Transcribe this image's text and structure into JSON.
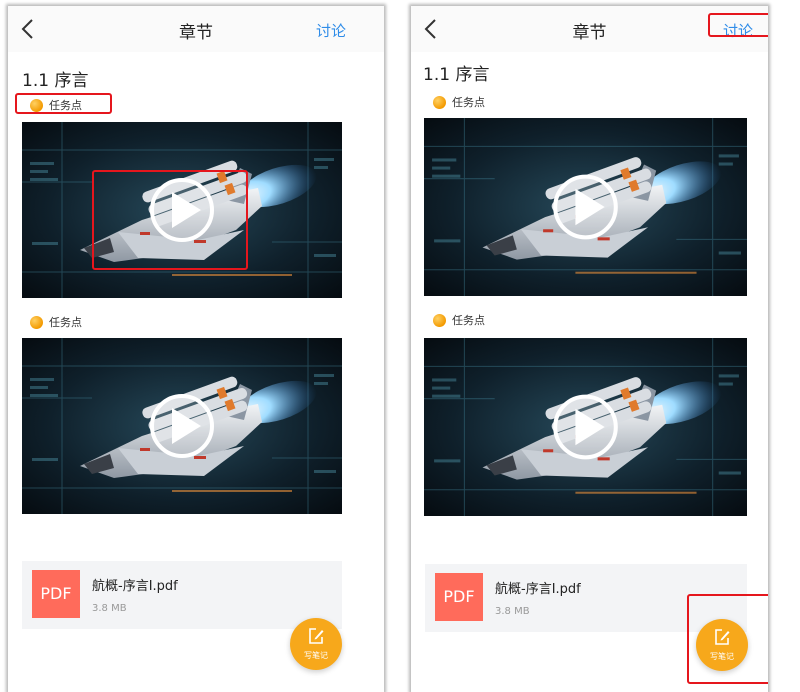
{
  "screens": [
    {
      "nav_title": "章节",
      "discuss_label": "讨论",
      "section_title": "1.1 序言",
      "task_points": [
        "任务点",
        "任务点"
      ],
      "file": {
        "type_label": "PDF",
        "name": "航概-序言I.pdf",
        "size": "3.8 MB"
      },
      "note_button_label": "写笔记"
    },
    {
      "nav_title": "章节",
      "discuss_label": "讨论",
      "section_title": "1.1 序言",
      "task_points": [
        "任务点",
        "任务点"
      ],
      "file": {
        "type_label": "PDF",
        "name": "航概-序言I.pdf",
        "size": "3.8 MB"
      },
      "note_button_label": "写笔记"
    }
  ],
  "colors": {
    "accent_blue": "#2f8ce8",
    "highlight_red": "#e5161d",
    "task_dot_orange": "#f39a00",
    "pdf_red": "#ff6b5b",
    "fab_orange": "#f7a81b"
  },
  "icons": [
    "back-icon",
    "play-icon",
    "task-dot-icon",
    "pdf-file-icon",
    "edit-note-icon"
  ]
}
